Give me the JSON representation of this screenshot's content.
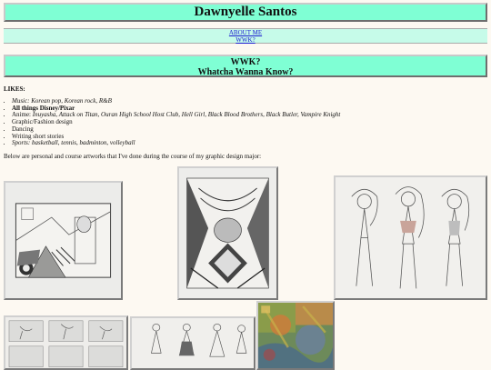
{
  "header": {
    "title": "Dawnyelle Santos"
  },
  "nav": {
    "links": [
      "ABOUT ME",
      "WWK?"
    ]
  },
  "section": {
    "title_line1": "WWK?",
    "title_line2": "Whatcha Wanna Know?"
  },
  "likes": {
    "heading": "LIKES:",
    "items": [
      {
        "label": "Music:",
        "text": "Korean pop, Korean rock, R&B"
      },
      {
        "label": "",
        "text": "All things Disney/Pixar"
      },
      {
        "label": "Anime:",
        "text": "Inuyasha, Attack on Titan, Ouran High School Host Club, Hell Girl, Black Blood Brothers, Black Butler, Vampire Knight"
      },
      {
        "label": "",
        "text": "Graphic/Fashion design"
      },
      {
        "label": "",
        "text": "Dancing"
      },
      {
        "label": "",
        "text": "Writing short stories"
      },
      {
        "label": "Sports:",
        "text": "basketball, tennis, badminton, volleyball"
      }
    ]
  },
  "intro": {
    "text": "Below are personal and course artworks that I've done during the course of my graphic design major:"
  },
  "colors": {
    "banner": "#7fffd4",
    "nav": "#c6fbe9",
    "link": "#1a1ad0",
    "page": "#fdf9f2"
  }
}
